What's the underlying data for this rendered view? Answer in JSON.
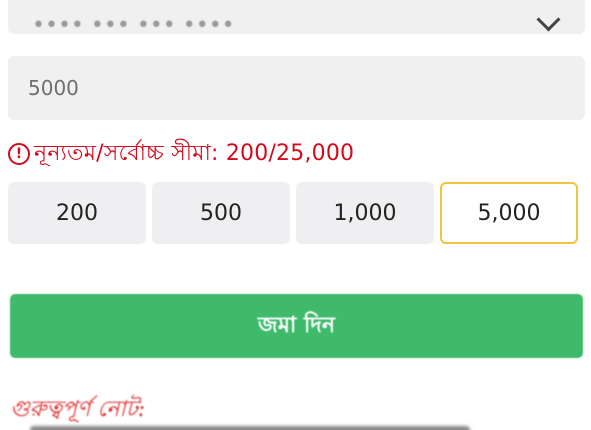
{
  "payment_method_select": {
    "selected_value": "•••• ••• ••• ••••"
  },
  "amount_input": {
    "value": "5000"
  },
  "limit_message": {
    "icon": "exclamation-circle-icon",
    "text": "নূন্যতম/সর্বোচ্চ সীমা: 200/25,000",
    "color": "#d40a1c"
  },
  "quick_amounts": [
    {
      "label": "200",
      "selected": false
    },
    {
      "label": "500",
      "selected": false
    },
    {
      "label": "1,000",
      "selected": false
    },
    {
      "label": "5,000",
      "selected": true
    }
  ],
  "submit": {
    "label": "জমা দিন",
    "color": "#3fba6b"
  },
  "note": {
    "title": "গুরুত্বপূর্ণ নোট:"
  },
  "colors": {
    "selected_border": "#f0c43c",
    "field_bg": "#f0f0f1"
  }
}
